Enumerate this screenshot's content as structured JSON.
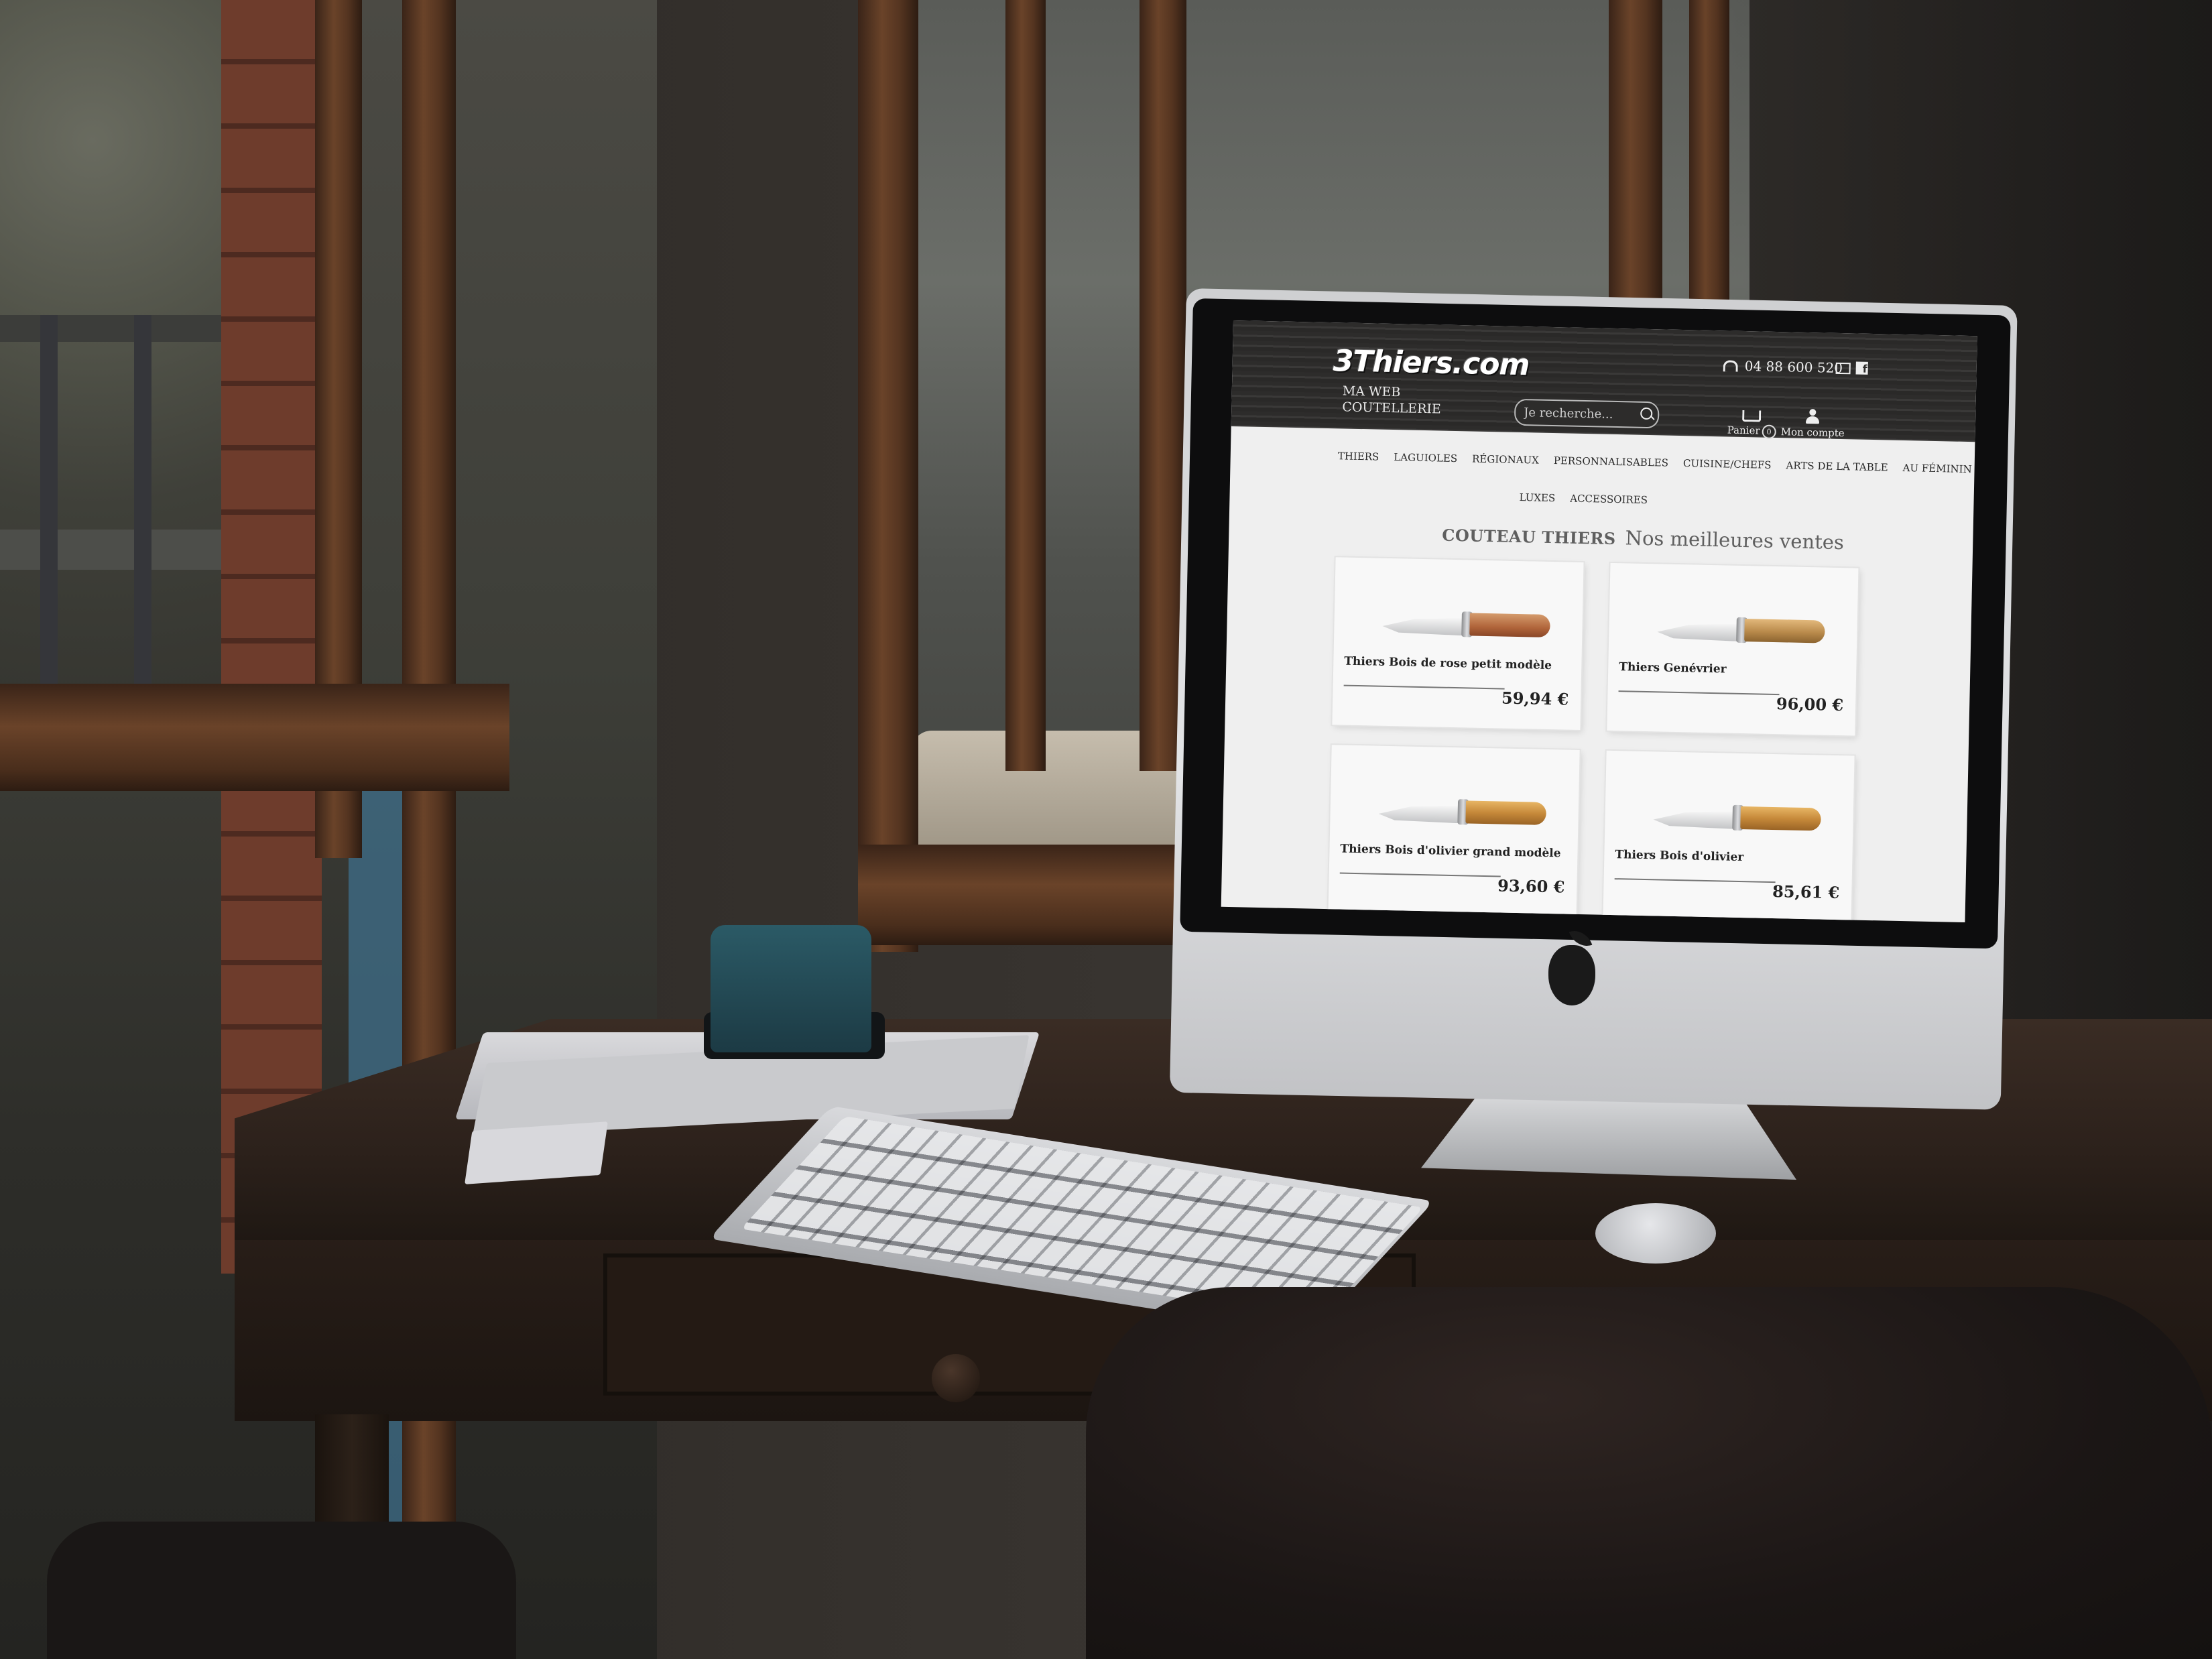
{
  "site": {
    "logo": "3Thiers.com",
    "tagline_line1": "MA WEB",
    "tagline_line2": "COUTELLERIE",
    "phone": "04 88 600 520",
    "search_placeholder": "Je recherche...",
    "cart_label": "Panier",
    "cart_count": "0",
    "account_label": "Mon compte"
  },
  "nav": {
    "items": [
      "THIERS",
      "LAGUIOLES",
      "RÉGIONAUX",
      "PERSONNALISABLES",
      "CUISINE/CHEFS",
      "ARTS DE LA TABLE",
      "AU FÉMININ",
      "LUXES",
      "ACCESSOIRES"
    ]
  },
  "section": {
    "title_bold": "COUTEAU THIERS",
    "title_light": "Nos meilleures ventes"
  },
  "products": [
    {
      "name": "Thiers Bois de rose petit modèle",
      "price": "59,94 €",
      "handle_color": "#b0643a"
    },
    {
      "name": "Thiers Genévrier",
      "price": "96,00 €",
      "handle_color": "#b98a4b"
    },
    {
      "name": "Thiers Bois d'olivier grand modèle",
      "price": "93,60 €",
      "handle_color": "#c6893a"
    },
    {
      "name": "Thiers Bois d'olivier",
      "price": "85,61 €",
      "handle_color": "#c6893a"
    }
  ],
  "colors": {
    "header_bg": "#2d2c2b",
    "page_bg": "#efefef"
  }
}
